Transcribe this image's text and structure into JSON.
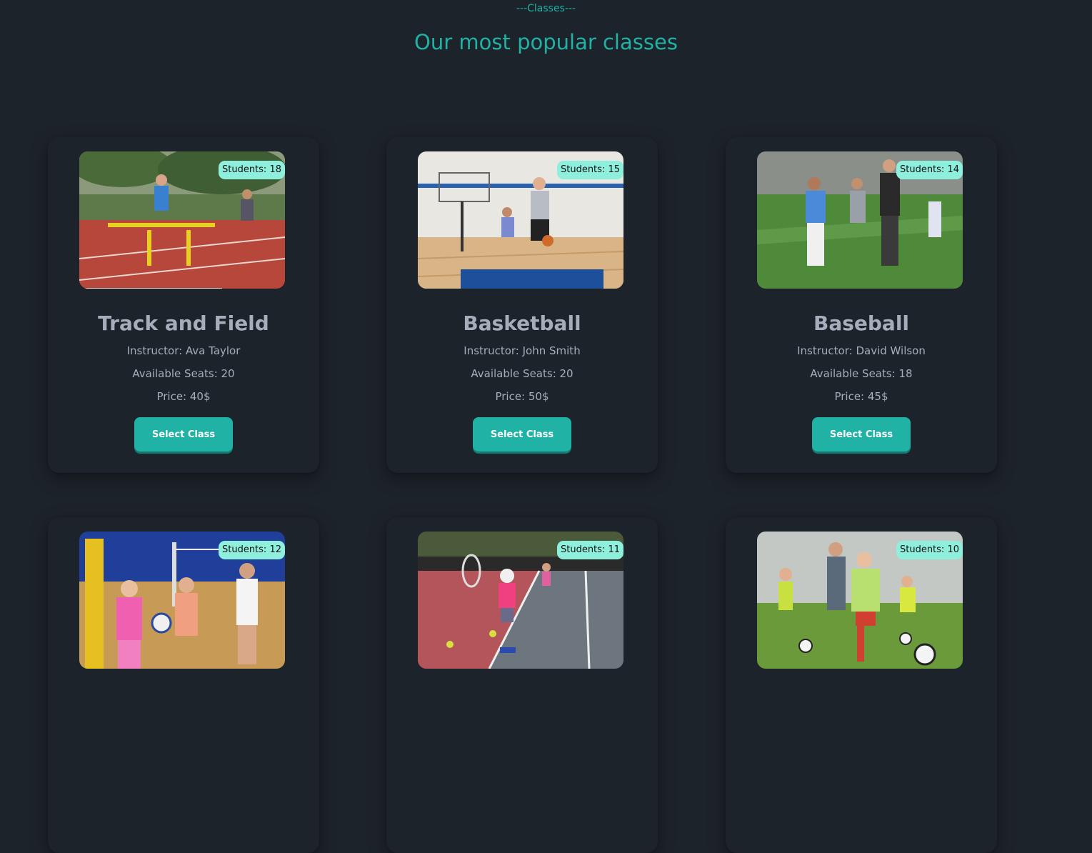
{
  "header": {
    "eyebrow": "---Classes---",
    "title": "Our most popular classes"
  },
  "classes": [
    {
      "name": "Track and Field",
      "students": "Students: 18",
      "instructor": "Instructor: Ava Taylor",
      "seats": "Available Seats: 20",
      "price": "Price: 40$",
      "button": "Select Class",
      "image": "track-and-field-photo"
    },
    {
      "name": "Basketball",
      "students": "Students: 15",
      "instructor": "Instructor: John Smith",
      "seats": "Available Seats: 20",
      "price": "Price: 50$",
      "button": "Select Class",
      "image": "basketball-photo"
    },
    {
      "name": "Baseball",
      "students": "Students: 14",
      "instructor": "Instructor: David Wilson",
      "seats": "Available Seats: 18",
      "price": "Price: 45$",
      "button": "Select Class",
      "image": "baseball-photo"
    },
    {
      "name": "",
      "students": "Students: 12",
      "image": "volleyball-photo"
    },
    {
      "name": "",
      "students": "Students: 11",
      "image": "tennis-photo"
    },
    {
      "name": "",
      "students": "Students: 10",
      "image": "soccer-photo"
    }
  ],
  "colors": {
    "accent": "#1fb2a5",
    "background": "#1d232a",
    "badge": "#8ef0dc",
    "text": "#a6adbb"
  }
}
